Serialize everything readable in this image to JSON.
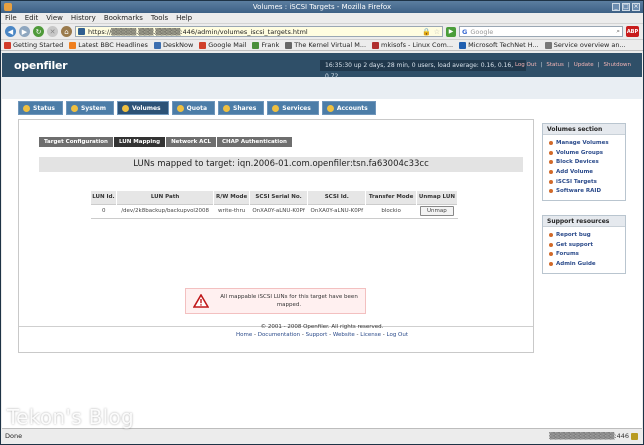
{
  "window": {
    "title": "Volumes : iSCSI Targets - Mozilla Firefox"
  },
  "menu": [
    "File",
    "Edit",
    "View",
    "History",
    "Bookmarks",
    "Tools",
    "Help"
  ],
  "url": "https://▒▒▒▒▒.▒▒▒.▒▒▒▒▒:446/admin/volumes_iscsi_targets.html",
  "search": {
    "engine": "G",
    "placeholder": "Google"
  },
  "bookmarks": [
    {
      "label": "Getting Started",
      "color": "#d13b2b"
    },
    {
      "label": "Latest BBC Headlines",
      "color": "#f07f1e"
    },
    {
      "label": "DeskNow",
      "color": "#3c6fb0"
    },
    {
      "label": "Google Mail",
      "color": "#d0402a"
    },
    {
      "label": "Frank",
      "color": "#4a8f3a"
    },
    {
      "label": "The Kernel Virtual M...",
      "color": "#666666"
    },
    {
      "label": "mkisofs - Linux Com...",
      "color": "#b03030"
    },
    {
      "label": "Microsoft TechNet H...",
      "color": "#1f5fb0"
    },
    {
      "label": "Service overview an...",
      "color": "#777777"
    }
  ],
  "header": {
    "logo": "openfiler",
    "status": "16:35:30 up 2 days, 28 min, 0 users, load average: 0.16, 0.16, 0.72",
    "links": [
      "Log Out",
      "Status",
      "Update",
      "Shutdown"
    ]
  },
  "tabs": [
    {
      "label": "Status",
      "active": false
    },
    {
      "label": "System",
      "active": false
    },
    {
      "label": "Volumes",
      "active": true
    },
    {
      "label": "Quota",
      "active": false
    },
    {
      "label": "Shares",
      "active": false
    },
    {
      "label": "Services",
      "active": false
    },
    {
      "label": "Accounts",
      "active": false
    }
  ],
  "subtabs": [
    {
      "label": "Target Configuration",
      "active": false
    },
    {
      "label": "LUN Mapping",
      "active": true
    },
    {
      "label": "Network ACL",
      "active": false
    },
    {
      "label": "CHAP Authentication",
      "active": false
    }
  ],
  "lun_title": "LUNs mapped to target: iqn.2006-01.com.openfiler:tsn.fa63004c33cc",
  "table": {
    "headers": [
      "LUN Id.",
      "LUN Path",
      "R/W Mode",
      "SCSI Serial No.",
      "SCSI Id.",
      "Transfer Mode",
      "Unmap LUN"
    ],
    "rows": [
      [
        "0",
        "/dev/2k8backup/backupvol2008",
        "write-thru",
        "OnXA0Y-aLNU-K0Pf",
        "OnXA0Y-aLNU-K0Pf",
        "blockio",
        "Unmap"
      ]
    ]
  },
  "warning": "All mappable iSCSI LUNs for this target have been mapped.",
  "sidebar": {
    "volumes": {
      "title": "Volumes section",
      "items": [
        "Manage Volumes",
        "Volume Groups",
        "Block Devices",
        "Add Volume",
        "iSCSI Targets",
        "Software RAID"
      ]
    },
    "support": {
      "title": "Support resources",
      "items": [
        "Report bug",
        "Get support",
        "Forums",
        "Admin Guide"
      ]
    }
  },
  "footer": {
    "copyright": "© 2001 - 2008 Openfiler. All rights reserved.",
    "links": [
      "Home",
      "Documentation",
      "Support",
      "Website",
      "License",
      "Log Out"
    ]
  },
  "status": {
    "text": "Done",
    "right": "▒▒▒▒▒▒▒▒▒▒▒▒▒:446"
  },
  "watermark": "Tekon's Blog"
}
